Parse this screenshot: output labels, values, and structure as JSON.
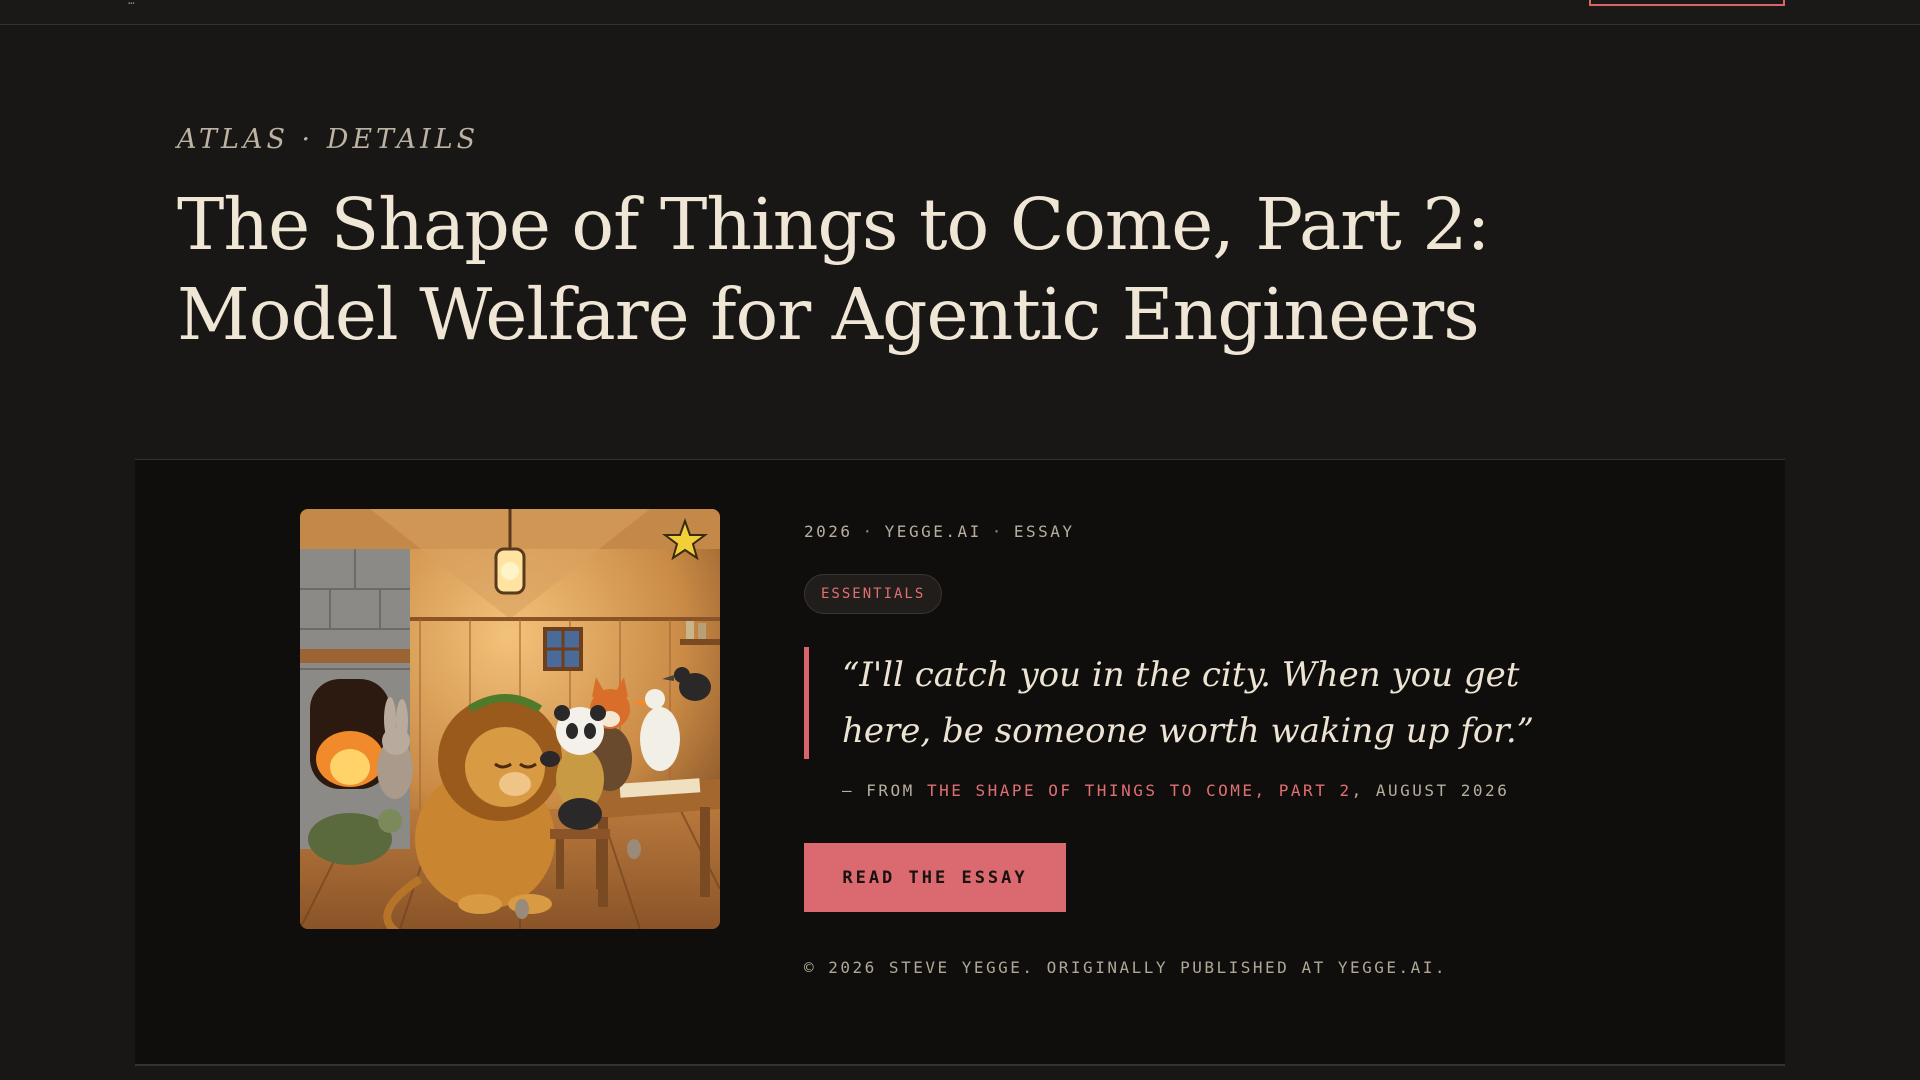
{
  "header": {
    "logo_text": "…",
    "top_button_label": ""
  },
  "eyebrow": "ATLAS · DETAILS",
  "title": "The Shape of Things to Come, Part 2: Model Welfare for Agentic Engineers",
  "card": {
    "image_alt": "Illustration of a lion being crowned by a panda in a wooden workshop with animals",
    "meta": {
      "year": "2026",
      "site": "YEGGE.AI",
      "type": "ESSAY"
    },
    "tag": "ESSENTIALS",
    "quote": "“I'll catch you in the city. When you get here, be someone worth waking up for.”",
    "source": {
      "prefix": "— FROM ",
      "link": "THE SHAPE OF THINGS TO COME, PART 2",
      "suffix": ", AUGUST 2026"
    },
    "read_button": "READ THE ESSAY",
    "copyright": "© 2026 STEVE YEGGE. ORIGINALLY PUBLISHED AT YEGGE.AI."
  },
  "colors": {
    "accent": "#da6a6f",
    "background": "#181715",
    "card_background": "#0f0e0c",
    "text": "#ece4d6"
  }
}
